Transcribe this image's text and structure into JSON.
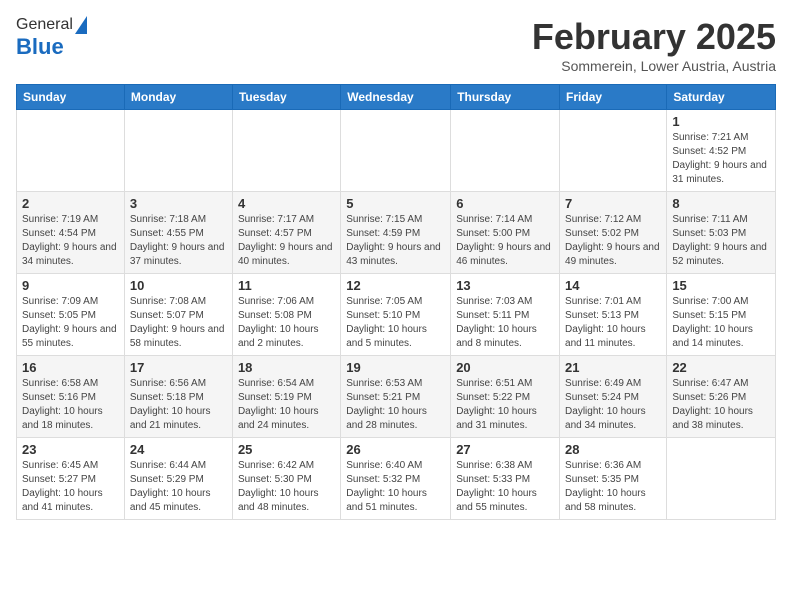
{
  "header": {
    "logo_general": "General",
    "logo_blue": "Blue",
    "month": "February 2025",
    "location": "Sommerein, Lower Austria, Austria"
  },
  "days_of_week": [
    "Sunday",
    "Monday",
    "Tuesday",
    "Wednesday",
    "Thursday",
    "Friday",
    "Saturday"
  ],
  "weeks": [
    [
      {
        "day": "",
        "info": ""
      },
      {
        "day": "",
        "info": ""
      },
      {
        "day": "",
        "info": ""
      },
      {
        "day": "",
        "info": ""
      },
      {
        "day": "",
        "info": ""
      },
      {
        "day": "",
        "info": ""
      },
      {
        "day": "1",
        "info": "Sunrise: 7:21 AM\nSunset: 4:52 PM\nDaylight: 9 hours and 31 minutes."
      }
    ],
    [
      {
        "day": "2",
        "info": "Sunrise: 7:19 AM\nSunset: 4:54 PM\nDaylight: 9 hours and 34 minutes."
      },
      {
        "day": "3",
        "info": "Sunrise: 7:18 AM\nSunset: 4:55 PM\nDaylight: 9 hours and 37 minutes."
      },
      {
        "day": "4",
        "info": "Sunrise: 7:17 AM\nSunset: 4:57 PM\nDaylight: 9 hours and 40 minutes."
      },
      {
        "day": "5",
        "info": "Sunrise: 7:15 AM\nSunset: 4:59 PM\nDaylight: 9 hours and 43 minutes."
      },
      {
        "day": "6",
        "info": "Sunrise: 7:14 AM\nSunset: 5:00 PM\nDaylight: 9 hours and 46 minutes."
      },
      {
        "day": "7",
        "info": "Sunrise: 7:12 AM\nSunset: 5:02 PM\nDaylight: 9 hours and 49 minutes."
      },
      {
        "day": "8",
        "info": "Sunrise: 7:11 AM\nSunset: 5:03 PM\nDaylight: 9 hours and 52 minutes."
      }
    ],
    [
      {
        "day": "9",
        "info": "Sunrise: 7:09 AM\nSunset: 5:05 PM\nDaylight: 9 hours and 55 minutes."
      },
      {
        "day": "10",
        "info": "Sunrise: 7:08 AM\nSunset: 5:07 PM\nDaylight: 9 hours and 58 minutes."
      },
      {
        "day": "11",
        "info": "Sunrise: 7:06 AM\nSunset: 5:08 PM\nDaylight: 10 hours and 2 minutes."
      },
      {
        "day": "12",
        "info": "Sunrise: 7:05 AM\nSunset: 5:10 PM\nDaylight: 10 hours and 5 minutes."
      },
      {
        "day": "13",
        "info": "Sunrise: 7:03 AM\nSunset: 5:11 PM\nDaylight: 10 hours and 8 minutes."
      },
      {
        "day": "14",
        "info": "Sunrise: 7:01 AM\nSunset: 5:13 PM\nDaylight: 10 hours and 11 minutes."
      },
      {
        "day": "15",
        "info": "Sunrise: 7:00 AM\nSunset: 5:15 PM\nDaylight: 10 hours and 14 minutes."
      }
    ],
    [
      {
        "day": "16",
        "info": "Sunrise: 6:58 AM\nSunset: 5:16 PM\nDaylight: 10 hours and 18 minutes."
      },
      {
        "day": "17",
        "info": "Sunrise: 6:56 AM\nSunset: 5:18 PM\nDaylight: 10 hours and 21 minutes."
      },
      {
        "day": "18",
        "info": "Sunrise: 6:54 AM\nSunset: 5:19 PM\nDaylight: 10 hours and 24 minutes."
      },
      {
        "day": "19",
        "info": "Sunrise: 6:53 AM\nSunset: 5:21 PM\nDaylight: 10 hours and 28 minutes."
      },
      {
        "day": "20",
        "info": "Sunrise: 6:51 AM\nSunset: 5:22 PM\nDaylight: 10 hours and 31 minutes."
      },
      {
        "day": "21",
        "info": "Sunrise: 6:49 AM\nSunset: 5:24 PM\nDaylight: 10 hours and 34 minutes."
      },
      {
        "day": "22",
        "info": "Sunrise: 6:47 AM\nSunset: 5:26 PM\nDaylight: 10 hours and 38 minutes."
      }
    ],
    [
      {
        "day": "23",
        "info": "Sunrise: 6:45 AM\nSunset: 5:27 PM\nDaylight: 10 hours and 41 minutes."
      },
      {
        "day": "24",
        "info": "Sunrise: 6:44 AM\nSunset: 5:29 PM\nDaylight: 10 hours and 45 minutes."
      },
      {
        "day": "25",
        "info": "Sunrise: 6:42 AM\nSunset: 5:30 PM\nDaylight: 10 hours and 48 minutes."
      },
      {
        "day": "26",
        "info": "Sunrise: 6:40 AM\nSunset: 5:32 PM\nDaylight: 10 hours and 51 minutes."
      },
      {
        "day": "27",
        "info": "Sunrise: 6:38 AM\nSunset: 5:33 PM\nDaylight: 10 hours and 55 minutes."
      },
      {
        "day": "28",
        "info": "Sunrise: 6:36 AM\nSunset: 5:35 PM\nDaylight: 10 hours and 58 minutes."
      },
      {
        "day": "",
        "info": ""
      }
    ]
  ]
}
